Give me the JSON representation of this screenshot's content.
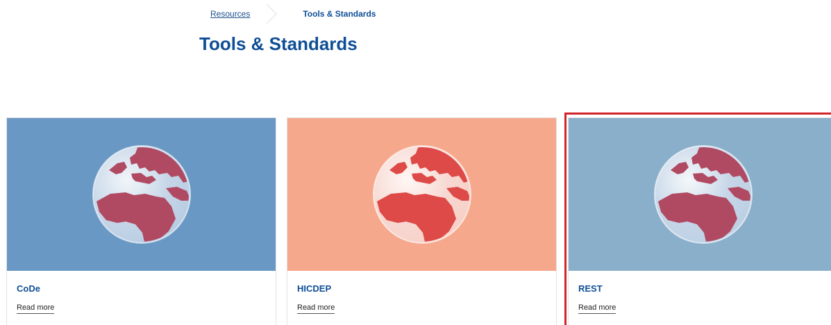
{
  "breadcrumb": {
    "parent_label": "Resources",
    "current_label": "Tools & Standards"
  },
  "page_title": "Tools & Standards",
  "cards": [
    {
      "title": "CoDe",
      "link_label": "Read more",
      "image_icon": "globe-icon",
      "image_bg": "#6a98c4",
      "land_color": "#b04a63",
      "ocean_color": "#c6d6e8"
    },
    {
      "title": "HICDEP",
      "link_label": "Read more",
      "image_icon": "globe-icon",
      "image_bg": "#f6a88c",
      "land_color": "#dd4a47",
      "ocean_color": "#f7d8d2"
    },
    {
      "title": "REST",
      "link_label": "Read more",
      "image_icon": "globe-icon",
      "image_bg": "#8aafcb",
      "land_color": "#b04a63",
      "ocean_color": "#c6d6e8"
    }
  ],
  "colors": {
    "accent": "#0e4e96",
    "selection_outline": "#d2232a"
  }
}
